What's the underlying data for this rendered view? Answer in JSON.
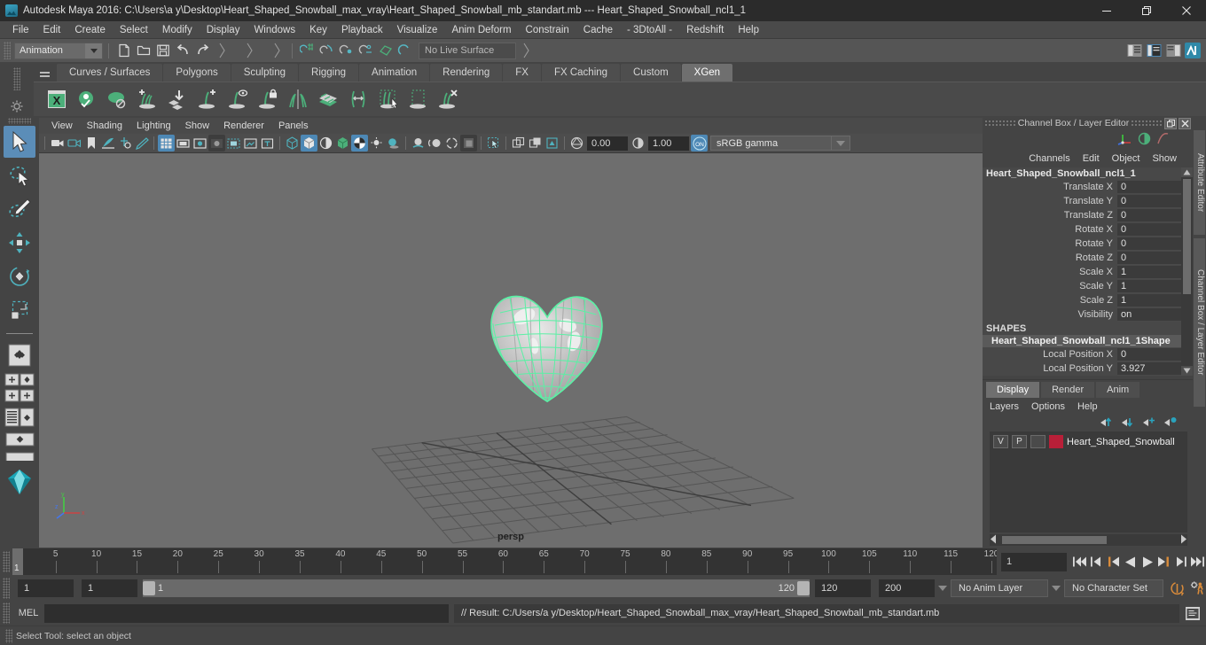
{
  "window": {
    "title": "Autodesk Maya 2016: C:\\Users\\a y\\Desktop\\Heart_Shaped_Snowball_max_vray\\Heart_Shaped_Snowball_mb_standart.mb  ---  Heart_Shaped_Snowball_ncl1_1",
    "minimize_label": "minimize",
    "maximize_label": "restore",
    "close_label": "close"
  },
  "menubar": {
    "items": [
      "File",
      "Edit",
      "Create",
      "Select",
      "Modify",
      "Display",
      "Windows",
      "Key",
      "Playback",
      "Visualize",
      "Anim Deform",
      "Constrain",
      "Cache",
      "- 3DtoAll -",
      "Redshift",
      "Help"
    ]
  },
  "statusline": {
    "menuset": "Animation",
    "live_surface": "No Live Surface"
  },
  "shelf": {
    "tabs": [
      "Curves / Surfaces",
      "Polygons",
      "Sculpting",
      "Rigging",
      "Animation",
      "Rendering",
      "FX",
      "FX Caching",
      "Custom",
      "XGen"
    ],
    "active_tab": "XGen",
    "icons": [
      "xgen-editor-icon",
      "xgen-preview-icon",
      "xgen-disable-preview-icon",
      "xgen-add-description-icon",
      "xgen-import-collection-icon",
      "xgen-add-guide-icon",
      "xgen-show-guide-icon",
      "xgen-lock-guide-icon",
      "xgen-mirror-guide-icon",
      "xgen-clump-map-icon",
      "xgen-scale-tool-icon",
      "xgen-select-guides-icon",
      "xgen-region-tool-icon",
      "xgen-delete-guide-icon"
    ]
  },
  "toolbox": {
    "items": [
      "select-tool",
      "lasso-select-tool",
      "paint-select-tool",
      "move-tool",
      "rotate-tool",
      "scale-tool",
      "four-view-layout",
      "two-pane-layout",
      "outliner-persp-layout",
      "persp-graph-layout",
      "hypershade-layout"
    ],
    "active": "select-tool"
  },
  "viewport": {
    "menus": [
      "View",
      "Shading",
      "Lighting",
      "Show",
      "Renderer",
      "Panels"
    ],
    "camera_label": "persp",
    "exposure": "0.00",
    "gamma": "1.00",
    "color_space": "sRGB gamma",
    "view_transform_toggle": "ON",
    "axis": {
      "x": "x",
      "y": "y",
      "z": "z"
    }
  },
  "channel_box": {
    "panel_title": "Channel Box / Layer Editor",
    "menus": [
      "Channels",
      "Edit",
      "Object",
      "Show"
    ],
    "node_name": "Heart_Shaped_Snowball_ncl1_1",
    "transform_channels": [
      {
        "label": "Translate X",
        "value": "0"
      },
      {
        "label": "Translate Y",
        "value": "0"
      },
      {
        "label": "Translate Z",
        "value": "0"
      },
      {
        "label": "Rotate X",
        "value": "0"
      },
      {
        "label": "Rotate Y",
        "value": "0"
      },
      {
        "label": "Rotate Z",
        "value": "0"
      },
      {
        "label": "Scale X",
        "value": "1"
      },
      {
        "label": "Scale Y",
        "value": "1"
      },
      {
        "label": "Scale Z",
        "value": "1"
      },
      {
        "label": "Visibility",
        "value": "on"
      }
    ],
    "shapes_header": "SHAPES",
    "shape_name": "Heart_Shaped_Snowball_ncl1_1Shape",
    "shape_channels": [
      {
        "label": "Local Position X",
        "value": "0"
      },
      {
        "label": "Local Position Y",
        "value": "3.927"
      }
    ]
  },
  "layer_editor": {
    "tabs": [
      "Display",
      "Render",
      "Anim"
    ],
    "active_tab": "Display",
    "menus": [
      "Layers",
      "Options",
      "Help"
    ],
    "layers": [
      {
        "visibility": "V",
        "playback": "P",
        "toggle": "",
        "color": "#b81f38",
        "name": "Heart_Shaped_Snowball"
      }
    ]
  },
  "right_rail": {
    "tabs": [
      "Attribute Editor",
      "Channel Box / Layer Editor"
    ]
  },
  "timeline": {
    "current_frame": "1",
    "ticks": [
      5,
      10,
      15,
      20,
      25,
      30,
      35,
      40,
      45,
      50,
      55,
      60,
      65,
      70,
      75,
      80,
      85,
      90,
      95,
      100,
      105,
      110,
      115,
      120
    ],
    "range_start": 1,
    "range_end": 120,
    "frame_field": "1",
    "playback_buttons": [
      "go-to-start-icon",
      "step-back-frame-icon",
      "step-back-key-icon",
      "play-backwards-icon",
      "play-forwards-icon",
      "step-forward-key-icon",
      "step-forward-frame-icon",
      "go-to-end-icon"
    ]
  },
  "range_slider": {
    "anim_start": "1",
    "range_start": "1",
    "slider_start_label": "1",
    "slider_end_label": "120",
    "range_end": "120",
    "anim_end": "200",
    "anim_layer": "No Anim Layer",
    "character_set": "No Character Set",
    "auto_key_icon": "auto-keyframe-icon",
    "anim_prefs_icon": "animation-preferences-icon"
  },
  "command_line": {
    "language_label": "MEL",
    "input_value": "",
    "result_text": "// Result: C:/Users/a y/Desktop/Heart_Shaped_Snowball_max_vray/Heart_Shaped_Snowball_mb_standart.mb",
    "script_editor_icon": "script-editor-icon"
  },
  "help_line": {
    "text": "Select Tool: select an object"
  },
  "colors": {
    "accent_blue": "#4d88b5",
    "xgen_green": "#4caf7a",
    "layer_red": "#b81f38",
    "key_orange": "#d98b3a"
  }
}
